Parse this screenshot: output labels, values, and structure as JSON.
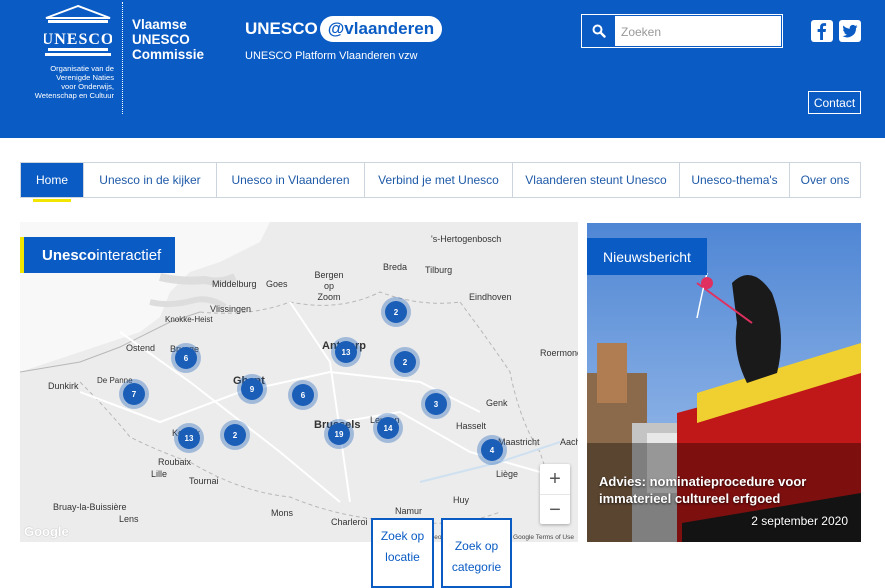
{
  "header": {
    "logo_word": "UNESCO",
    "org_lines": [
      "Organisatie van de",
      "Verenigde Naties",
      "voor Onderwijs,",
      "Wetenschap en Cultuur"
    ],
    "commission_lines": [
      "Vlaamse",
      "UNESCO",
      "Commissie"
    ],
    "platform_logo_left": "UNESCO",
    "platform_logo_right": "@vlaanderen",
    "platform_subtitle": "UNESCO Platform Vlaanderen vzw",
    "search_placeholder": "Zoeken",
    "contact_label": "Contact",
    "brand_color": "#0a5bc4",
    "accent_color": "#f2e500"
  },
  "nav": {
    "tabs": [
      "Home",
      "Unesco in de kijker",
      "Unesco in Vlaanderen",
      "Verbind je met Unesco",
      "Vlaanderen steunt Unesco",
      "Unesco-thema's",
      "Over ons"
    ],
    "active": "Home"
  },
  "map": {
    "title_bold": "Unesco",
    "title_rest": " interactief",
    "cities": [
      "'s-Hertogenbosch",
      "Breda",
      "Tilburg",
      "Bergen op Zoom",
      "Middelburg",
      "Goes",
      "Vlissingen",
      "Eindhoven",
      "Knokke-Heist",
      "Ostend",
      "Brugge",
      "Antwerp",
      "Roermond",
      "Dunkirk",
      "De Panne",
      "Ghent",
      "Genk",
      "Kortrijk",
      "Brussels",
      "Leuven",
      "Hasselt",
      "Maastricht",
      "Aachen",
      "Roubaix",
      "Lille",
      "Tournai",
      "Liège",
      "Huy",
      "Bruay-la-Buissière",
      "Lens",
      "Mons",
      "Charleroi",
      "Namur"
    ],
    "clusters": [
      2,
      13,
      2,
      6,
      9,
      6,
      7,
      3,
      14,
      19,
      13,
      2,
      4
    ],
    "zoom_in": "+",
    "zoom_out": "−",
    "google": "Google",
    "attribution": "Map data ©2020 GeoBasis-DE/BKG (©2009), Google   Terms of Use",
    "btn_locatie": "Zoek op locatie",
    "btn_categorie": "Zoek op categorie"
  },
  "news": {
    "tag": "Nieuwsbericht",
    "title": "Advies: nominatieprocedure voor immaterieel cultureel erfgoed",
    "date": "2 september 2020"
  }
}
